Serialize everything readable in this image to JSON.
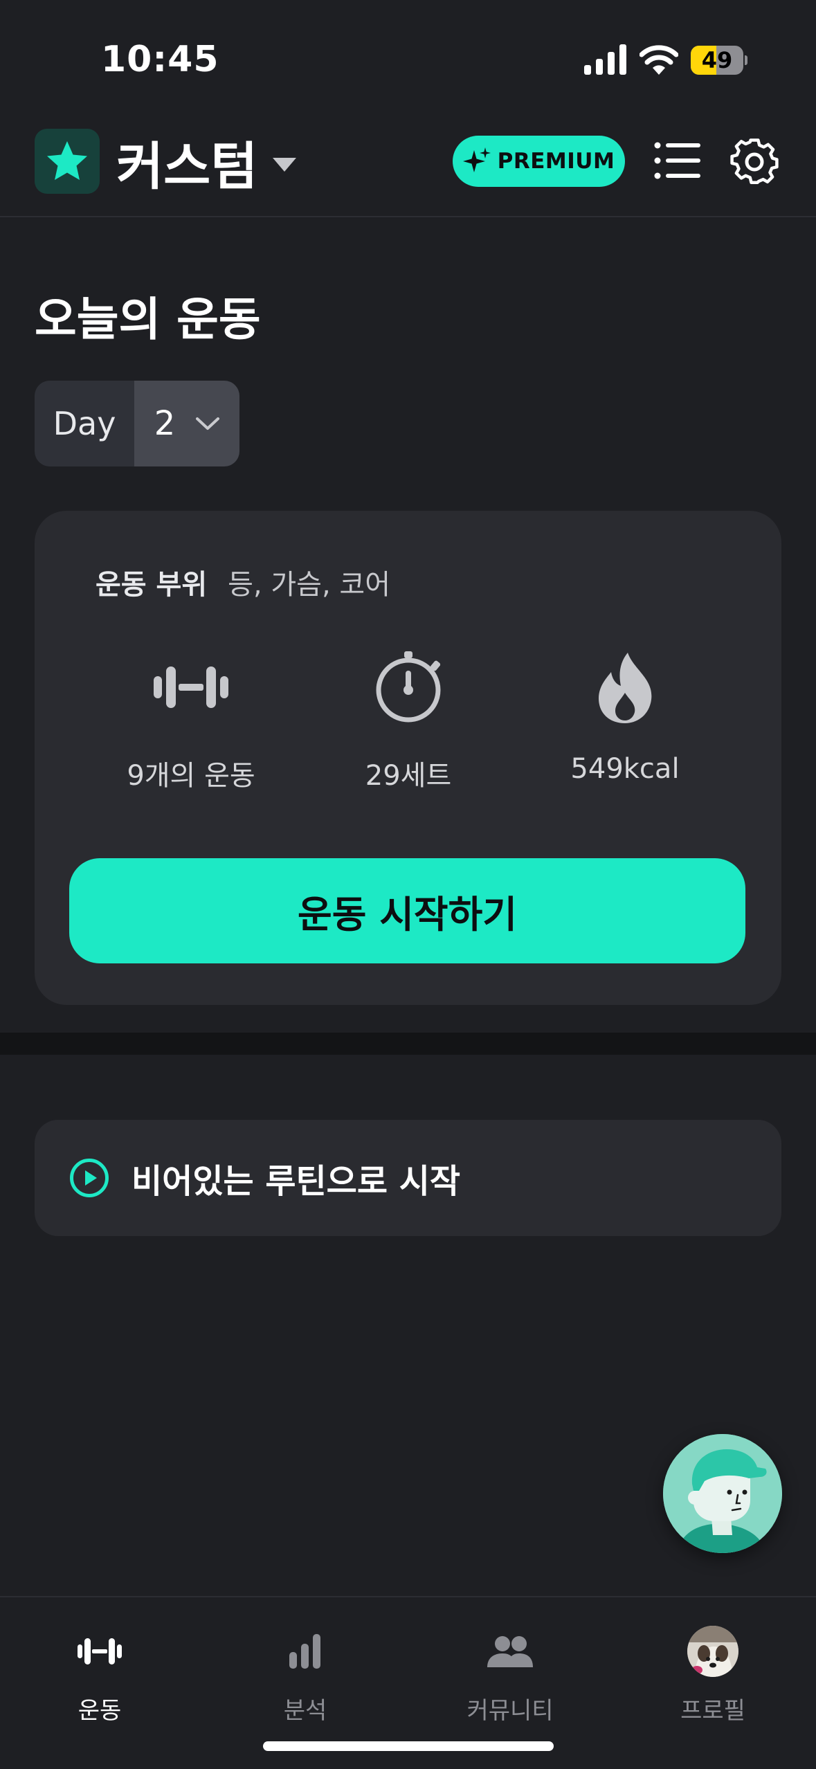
{
  "status_bar": {
    "time": "10:45",
    "battery": "49",
    "battery_level": 0.49
  },
  "header": {
    "workspace_name": "커스텀",
    "premium_label": "PREMIUM"
  },
  "colors": {
    "accent": "#1de9c5",
    "background": "#1e1f23",
    "card": "#2a2b30"
  },
  "today": {
    "title": "오늘의 운동",
    "day_label": "Day",
    "day_value": "2"
  },
  "workout": {
    "body_parts_label": "운동 부위",
    "body_parts": "등, 가슴, 코어",
    "stats": [
      {
        "icon": "dumbbell-icon",
        "text": "9개의 운동"
      },
      {
        "icon": "stopwatch-icon",
        "text": "29세트"
      },
      {
        "icon": "flame-icon",
        "text": "549kcal"
      }
    ],
    "start_label": "운동 시작하기"
  },
  "empty_routine": {
    "label": "비어있는 루틴으로 시작"
  },
  "tabs": [
    {
      "icon": "dumbbell-icon",
      "label": "운동",
      "active": true
    },
    {
      "icon": "bar-chart-icon",
      "label": "분석",
      "active": false
    },
    {
      "icon": "people-icon",
      "label": "커뮤니티",
      "active": false
    },
    {
      "icon": "avatar",
      "label": "프로필",
      "active": false
    }
  ]
}
